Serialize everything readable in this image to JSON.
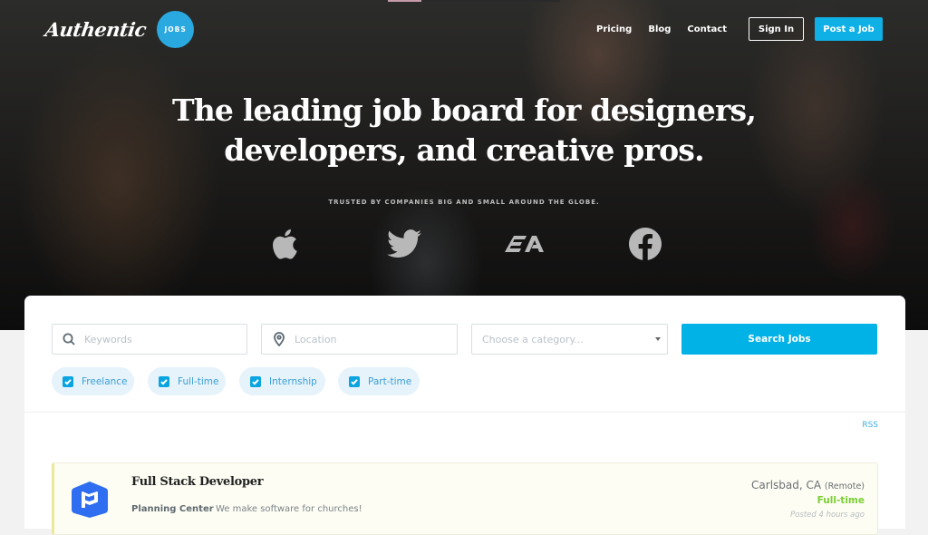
{
  "header": {
    "logo_text": "Authentic",
    "logo_badge": "JOBS",
    "nav": [
      {
        "label": "Pricing"
      },
      {
        "label": "Blog"
      },
      {
        "label": "Contact"
      }
    ],
    "sign_in_label": "Sign In",
    "post_job_label": "Post a Job"
  },
  "hero": {
    "headline_line1": "The leading job board for designers,",
    "headline_line2": "developers, and creative pros.",
    "trusted_text": "TRUSTED BY COMPANIES BIG AND SMALL AROUND THE GLOBE.",
    "brands": [
      {
        "icon": "apple-icon",
        "name": "Apple"
      },
      {
        "icon": "twitter-icon",
        "name": "Twitter"
      },
      {
        "icon": "ea-icon",
        "name": "EA"
      },
      {
        "icon": "facebook-icon",
        "name": "Facebook"
      }
    ],
    "ea_text": "EA"
  },
  "search": {
    "keywords_placeholder": "Keywords",
    "keywords_value": "",
    "location_placeholder": "Location",
    "location_value": "",
    "category_placeholder": "Choose a category...",
    "search_label": "Search Jobs",
    "filters": [
      {
        "label": "Freelance",
        "checked": true
      },
      {
        "label": "Full-time",
        "checked": true
      },
      {
        "label": "Internship",
        "checked": true
      },
      {
        "label": "Part-time",
        "checked": true
      }
    ]
  },
  "listing": {
    "rss_label": "RSS",
    "jobs": [
      {
        "title": "Full Stack Developer",
        "company": "Planning Center",
        "description": "We make software for churches!",
        "location": "Carlsbad, CA",
        "remote": "(Remote)",
        "type": "Full-time",
        "posted": "Posted 4 hours ago"
      }
    ]
  },
  "colors": {
    "accent": "#00b2e6",
    "logo_badge": "#2aa8e0",
    "full_time": "#7bcf34",
    "company_logo": "#2f6ef0"
  }
}
